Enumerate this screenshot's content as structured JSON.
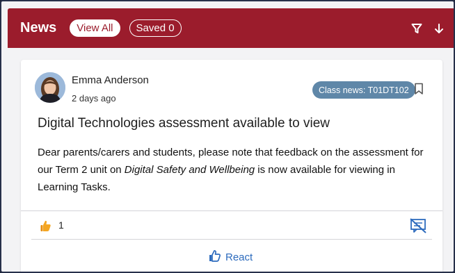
{
  "header": {
    "title": "News",
    "view_all_label": "View All",
    "saved_label": "Saved 0",
    "filter_icon": "filter-icon",
    "sort_icon": "arrow-down-icon"
  },
  "post": {
    "author": "Emma Anderson",
    "time": "2 days ago",
    "class_badge": "Class news: T01DT102",
    "headline": "Digital Technologies assessment available to view",
    "body_before": "Dear parents/carers and students, please note that feedback on the assessment for our Term 2 unit on ",
    "body_italic": "Digital Safety and Wellbeing",
    "body_after": " is now available for viewing in Learning Tasks.",
    "reaction_count": "1",
    "react_label": "React"
  },
  "colors": {
    "header_bg": "#9b1c2c",
    "badge_bg": "#5f87a8",
    "link_blue": "#2d6bbd"
  }
}
